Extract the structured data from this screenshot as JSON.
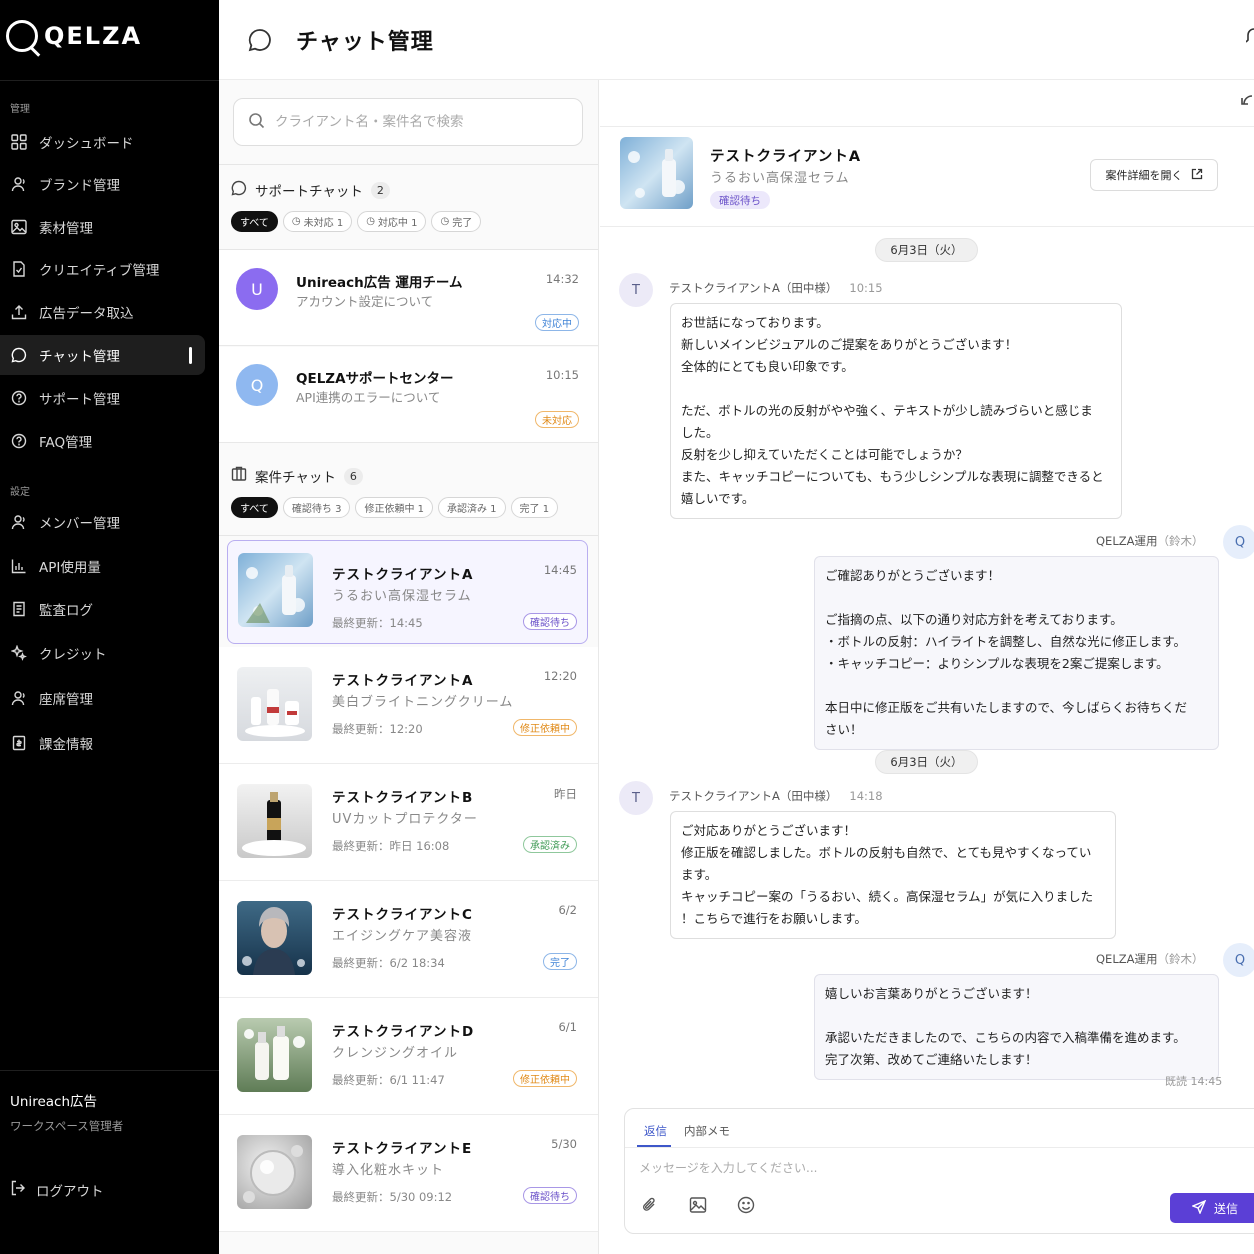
{
  "brand": {
    "name": "QELZA"
  },
  "sidebar": {
    "section_manage": "管理",
    "section_settings": "設定",
    "items": [
      {
        "label": "ダッシュボード",
        "icon": "grid-icon"
      },
      {
        "label": "ブランド管理",
        "icon": "user-icon"
      },
      {
        "label": "素材管理",
        "icon": "image-icon"
      },
      {
        "label": "クリエイティブ管理",
        "icon": "doc-icon"
      },
      {
        "label": "広告データ取込",
        "icon": "upload-icon"
      },
      {
        "label": "チャット管理",
        "icon": "chat-icon"
      },
      {
        "label": "サポート管理",
        "icon": "help-icon"
      },
      {
        "label": "FAQ管理",
        "icon": "help-icon"
      },
      {
        "label": "メンバー管理",
        "icon": "user-icon"
      },
      {
        "label": "API使用量",
        "icon": "bar-chart-icon"
      },
      {
        "label": "監査ログ",
        "icon": "log-icon"
      },
      {
        "label": "クレジット",
        "icon": "sparkle-icon"
      },
      {
        "label": "座席管理",
        "icon": "user-icon"
      },
      {
        "label": "課金情報",
        "icon": "billing-icon"
      }
    ],
    "workspace_name": "Unireach広告",
    "workspace_role": "ワークスペース管理者",
    "logout": "ログアウト"
  },
  "header": {
    "title": "チャット管理"
  },
  "list": {
    "search_placeholder": "クライアント名・案件名で検索",
    "support": {
      "title": "サポートチャット",
      "count": "2",
      "filters": [
        "すべて",
        "未対応 1",
        "対応中 1",
        "完了"
      ],
      "items": [
        {
          "avatar": "U",
          "name": "Unireach広告 運用チーム",
          "subject": "アカウント設定について",
          "time": "14:32",
          "status": "対応中"
        },
        {
          "avatar": "Q",
          "name": "QELZAサポートセンター",
          "subject": "API連携のエラーについて",
          "time": "10:15",
          "status": "未対応"
        }
      ]
    },
    "cases": {
      "title": "案件チャット",
      "count": "6",
      "filters": [
        "すべて",
        "確認待ち 3",
        "修正依頼中 1",
        "承認済み 1",
        "完了 1"
      ],
      "items": [
        {
          "client": "テストクライアントA",
          "product": "うるおい高保湿セラム",
          "updated": "最終更新：14:45",
          "time": "14:45",
          "status": "確認待ち"
        },
        {
          "client": "テストクライアントA",
          "product": "美白ブライトニングクリーム",
          "updated": "最終更新：12:20",
          "time": "12:20",
          "status": "修正依頼中"
        },
        {
          "client": "テストクライアントB",
          "product": "UVカットプロテクター",
          "updated": "最終更新：昨日 16:08",
          "time": "昨日",
          "status": "承認済み"
        },
        {
          "client": "テストクライアントC",
          "product": "エイジングケア美容液",
          "updated": "最終更新：6/2 18:34",
          "time": "6/2",
          "status": "完了"
        },
        {
          "client": "テストクライアントD",
          "product": "クレンジングオイル",
          "updated": "最終更新：6/1 11:47",
          "time": "6/1",
          "status": "修正依頼中"
        },
        {
          "client": "テストクライアントE",
          "product": "導入化粧水キット",
          "updated": "最終更新：5/30 09:12",
          "time": "5/30",
          "status": "確認待ち"
        }
      ]
    }
  },
  "chat": {
    "client": "テストクライアントA",
    "product": "うるおい高保湿セラム",
    "status": "確認待ち",
    "detail_button": "案件詳細を開く",
    "messages": [
      {
        "date": "6月3日（火）",
        "sender": "テストクライアントA（田中様）",
        "time": "10:15",
        "avatar": "T",
        "text": "お世話になっております。\n新しいメインビジュアルのご提案をありがとうございます！\n全体的にとても良い印象です。\n\nただ、ボトルの光の反射がやや強く、テキストが少し読みづらいと感じま\nした。\n反射を少し抑えていただくことは可能でしょうか？\nまた、キャッチコピーについても、もう少しシンプルな表現に調整できると\n嬉しいです。"
      },
      {
        "sender": "QELZA運用",
        "sender_sub": "（鈴木）",
        "avatar": "Q",
        "text": "ご確認ありがとうございます！\n\nご指摘の点、以下の通り対応方針を考えております。\n・ボトルの反射：ハイライトを調整し、自然な光に修正します。\n・キャッチコピー：よりシンプルな表現を2案ご提案します。\n\n本日中に修正版をご共有いたしますので、今しばらくお待ちくだ\nさい！"
      },
      {
        "date": "6月3日（火）",
        "sender": "テストクライアントA（田中様）",
        "time": "14:18",
        "avatar": "T",
        "text": "ご対応ありがとうございます！\n修正版を確認しました。ボトルの反射も自然で、とても見やすくなってい\nます。\nキャッチコピー案の「うるおい、続く。高保湿セラム」が気に入りました\n！こちらで進行をお願いします。"
      },
      {
        "sender": "QELZA運用",
        "sender_sub": "（鈴木）",
        "avatar": "Q",
        "read": "既読 14:45",
        "text": "嬉しいお言葉ありがとうございます！\n\n承認いただきましたので、こちらの内容で入稿準備を進めます。\n完了次第、改めてご連絡いたします！"
      }
    ],
    "composer": {
      "tab_reply": "返信",
      "tab_memo": "内部メモ",
      "placeholder": "メッセージを入力してください...",
      "send": "送信"
    }
  },
  "colors": {
    "accent": "#5b3fd6",
    "sidebar_bg": "#000000",
    "avatar_u": "#8b6cf0",
    "avatar_q": "#8fb8f0"
  }
}
